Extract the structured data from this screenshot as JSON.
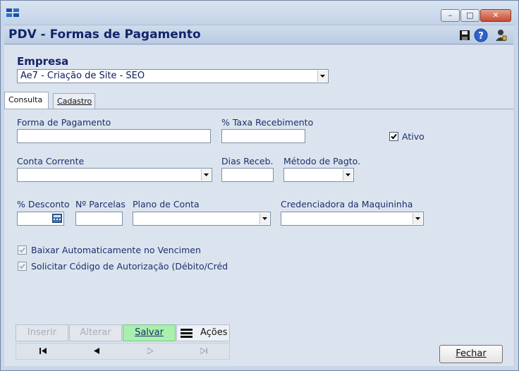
{
  "window": {
    "title": "PDV - Formas de Pagamento",
    "controls": {
      "minimize": "–",
      "maximize": "□",
      "close": "✕"
    }
  },
  "empresa": {
    "label": "Empresa",
    "value": "Ae7 - Criação de Site - SEO"
  },
  "tabs": [
    {
      "label": "Consulta",
      "active": true
    },
    {
      "label": "Cadastro",
      "active": false
    }
  ],
  "form": {
    "forma_pagamento": {
      "label": "Forma de Pagamento",
      "value": ""
    },
    "taxa_recebimento": {
      "label": "% Taxa Recebimento",
      "value": ""
    },
    "ativo": {
      "label": "Ativo",
      "checked": true
    },
    "conta_corrente": {
      "label": "Conta Corrente",
      "value": ""
    },
    "dias_receb": {
      "label": "Dias  Receb.",
      "value": ""
    },
    "metodo_pagto": {
      "label": "Método de Pagto.",
      "value": ""
    },
    "desconto": {
      "label": "% Desconto",
      "value": ""
    },
    "parcelas": {
      "label": "Nº Parcelas",
      "value": ""
    },
    "plano_conta": {
      "label": "Plano de Conta",
      "value": ""
    },
    "credenciadora": {
      "label": "Credenciadora da Maquininha",
      "value": ""
    },
    "baixar_auto": {
      "label": "Baixar Automaticamente no Vencimen",
      "checked": false,
      "enabled": false
    },
    "solicitar_codigo": {
      "label": "Solicitar Código de Autorização (Débito/Créd",
      "checked": false,
      "enabled": false
    }
  },
  "toolbar": {
    "inserir": "Inserir",
    "alterar": "Alterar",
    "salvar": "Salvar",
    "acoes": "Ações"
  },
  "footer": {
    "fechar": "Fechar"
  },
  "colors": {
    "accent_title": "#12246a",
    "label": "#1b2f6b",
    "save_button": "#a9efae"
  }
}
